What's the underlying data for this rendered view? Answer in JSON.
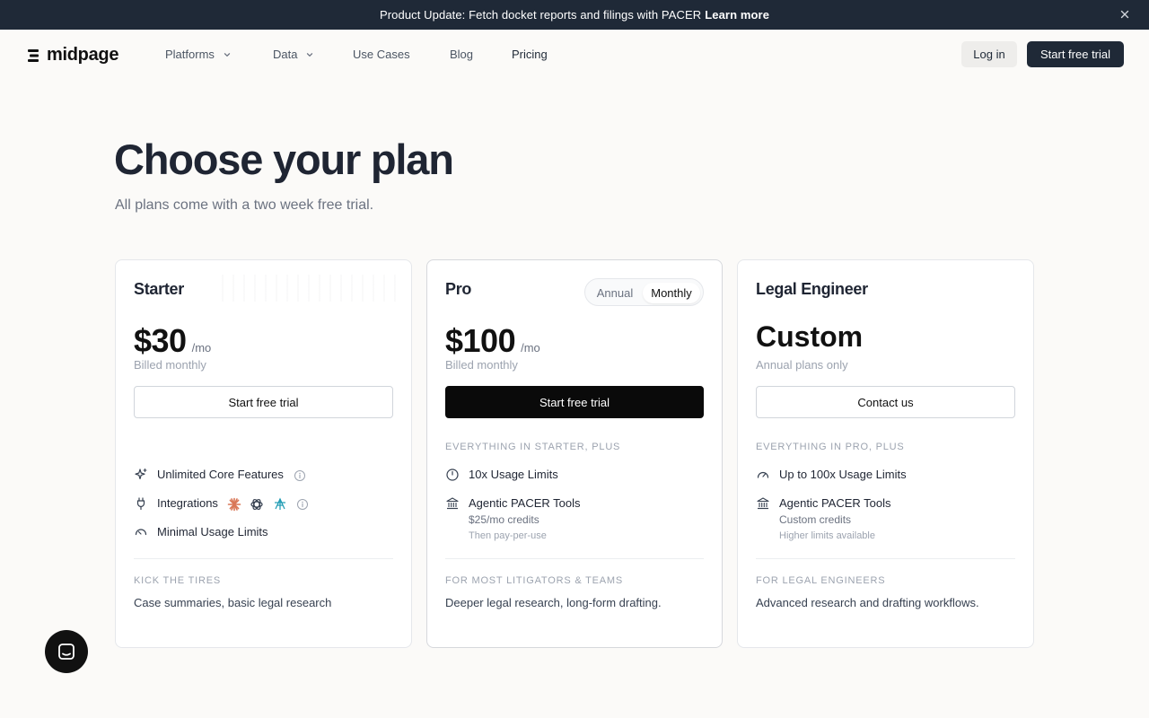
{
  "banner": {
    "text": "Product Update: Fetch docket reports and filings with PACER",
    "link": "Learn more",
    "close_icon": "close-icon"
  },
  "nav": {
    "logo": "midpage",
    "items": [
      {
        "label": "Platforms",
        "has_dropdown": true
      },
      {
        "label": "Data",
        "has_dropdown": true
      },
      {
        "label": "Use Cases",
        "has_dropdown": false
      },
      {
        "label": "Blog",
        "has_dropdown": false
      },
      {
        "label": "Pricing",
        "has_dropdown": false
      }
    ],
    "login": "Log in",
    "cta": "Start free trial"
  },
  "hero": {
    "title": "Choose your plan",
    "subtitle": "All plans come with a two week free trial."
  },
  "plans": [
    {
      "name": "Starter",
      "price": "$30",
      "per": "/mo",
      "billed": "Billed monthly",
      "cta": "Start free trial",
      "features": [
        {
          "text": "Unlimited Core Features",
          "icon": "sparkle-icon"
        },
        {
          "text": "Integrations",
          "icon": "plug-icon"
        },
        {
          "text": "Minimal Usage Limits",
          "icon": "gauge-icon"
        }
      ],
      "footer_label": "KICK THE TIRES",
      "footer_desc": "Case summaries, basic legal research"
    },
    {
      "name": "Pro",
      "price": "$100",
      "per": "/mo",
      "billed": "Billed monthly",
      "cta": "Start free trial",
      "toggle": {
        "annual": "Annual",
        "monthly": "Monthly",
        "selected": "Monthly"
      },
      "section_label": "EVERYTHING IN STARTER, PLUS",
      "features": [
        {
          "text": "10x Usage Limits",
          "icon": "gauge-icon"
        },
        {
          "text": "Agentic PACER Tools",
          "sub1": "$25/mo credits",
          "sub2": "Then pay-per-use",
          "icon": "bank-icon"
        }
      ],
      "footer_label": "FOR MOST LITIGATORS & TEAMS",
      "footer_desc": "Deeper legal research, long-form drafting."
    },
    {
      "name": "Legal Engineer",
      "price": "Custom",
      "billed": "Annual plans only",
      "cta": "Contact us",
      "section_label": "EVERYTHING IN PRO, PLUS",
      "features": [
        {
          "text": "Up to 100x Usage Limits",
          "icon": "gauge-icon"
        },
        {
          "text": "Agentic PACER Tools",
          "sub1": "Custom credits",
          "sub2": "Higher limits available",
          "icon": "bank-icon"
        }
      ],
      "footer_label": "FOR LEGAL ENGINEERS",
      "footer_desc": "Advanced research and drafting workflows."
    }
  ],
  "colors": {
    "dark": "#1f2937",
    "black_button": "#0a0a0a",
    "page_bg": "#fbfaf8",
    "claude_orange": "#d97757",
    "copilot_teal": "#1e9bb3"
  }
}
